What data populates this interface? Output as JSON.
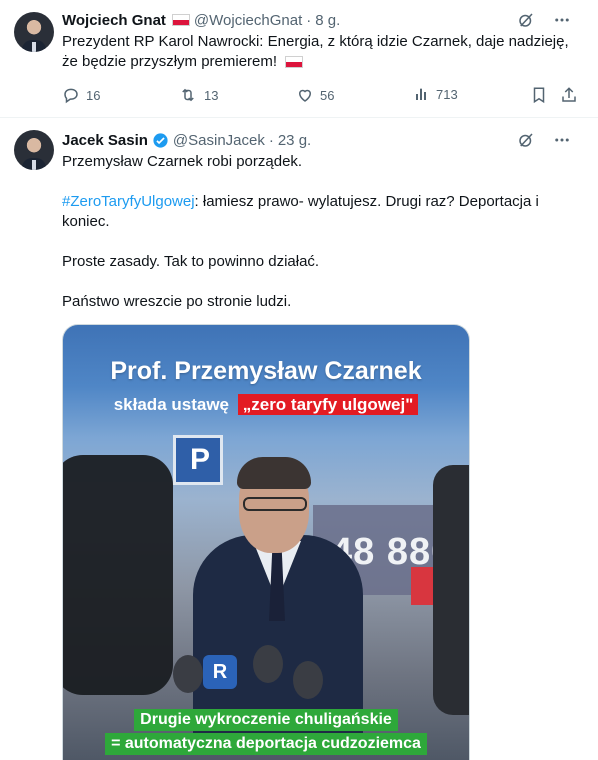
{
  "tweets": [
    {
      "author_name": "Wojciech Gnat",
      "handle": "@WojciechGnat",
      "separator": "·",
      "time": "8 g.",
      "text_line1": "Prezydent RP Karol Nawrocki: Energia, z którą idzie Czarnek, daje nadzieję,",
      "text_line2": "że będzie przyszłym premierem!",
      "actions": {
        "replies": "16",
        "retweets": "13",
        "likes": "56",
        "views": "713"
      }
    },
    {
      "author_name": "Jacek Sasin",
      "handle": "@SasinJacek",
      "separator": "·",
      "time": "23 g.",
      "line1": "Przemysław Czarnek robi porządek.",
      "hashtag": "#ZeroTaryfyUlgowej",
      "line2_rest": ": łamiesz prawo- wylatujesz. Drugi raz? Deportacja i",
      "line2_cont": "koniec.",
      "line3": "Proste zasady. Tak to powinno działać.",
      "line4": "Państwo wreszcie po stronie ludzi.",
      "media": {
        "title": "Prof. Przemysław Czarnek",
        "sub_prefix": "składa ustawę",
        "sub_highlight": "„zero taryfy ulgowej\"",
        "bg_number": "48 880",
        "mic_label": "R",
        "banner1": "Drugie wykroczenie chuligańskie",
        "banner2": "= automatyczna deportacja cudzoziemca"
      }
    }
  ],
  "icons": {
    "grok": "grok-icon",
    "more": "more-icon",
    "reply": "reply-icon",
    "retweet": "retweet-icon",
    "like": "heart-icon",
    "views": "views-icon",
    "bookmark": "bookmark-icon",
    "share": "share-icon",
    "verified": "verified-badge-icon",
    "flag": "poland-flag-icon"
  },
  "colors": {
    "link": "#1d9bf0",
    "text": "#0f1419",
    "muted": "#536471",
    "banner_green": "#2ea83a",
    "highlight_red": "#e31b23"
  }
}
